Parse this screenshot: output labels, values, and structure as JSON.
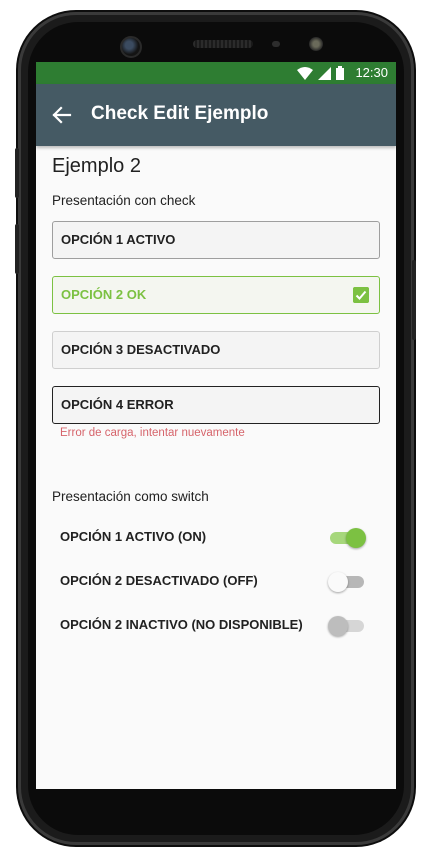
{
  "status_bar": {
    "time": "12:30"
  },
  "toolbar": {
    "title": "Check Edit Ejemplo",
    "back_icon": "arrow-left-icon"
  },
  "heading": "Ejemplo 2",
  "check_section": {
    "label": "Presentación con check",
    "options": [
      {
        "label": "OPCIÓN 1 ACTIVO",
        "state": "active"
      },
      {
        "label": "OPCIÓN 2 OK",
        "state": "ok",
        "checked": true
      },
      {
        "label": "OPCIÓN 3 DESACTIVADO",
        "state": "disabled"
      },
      {
        "label": "OPCIÓN 4 ERROR",
        "state": "error"
      }
    ],
    "error_message": "Error de carga, intentar nuevamente"
  },
  "switch_section": {
    "label": "Presentación como switch",
    "switches": [
      {
        "label": "OPCIÓN 1 ACTIVO (ON)",
        "on": true,
        "enabled": true
      },
      {
        "label": "OPCIÓN 2 DESACTIVADO (OFF)",
        "on": false,
        "enabled": true
      },
      {
        "label": "OPCIÓN 2 INACTIVO (NO DISPONIBLE)",
        "on": false,
        "enabled": false
      }
    ]
  },
  "colors": {
    "status_bar": "#2e7d32",
    "toolbar": "#455a64",
    "accent": "#7cc142",
    "error": "#d6646b"
  }
}
